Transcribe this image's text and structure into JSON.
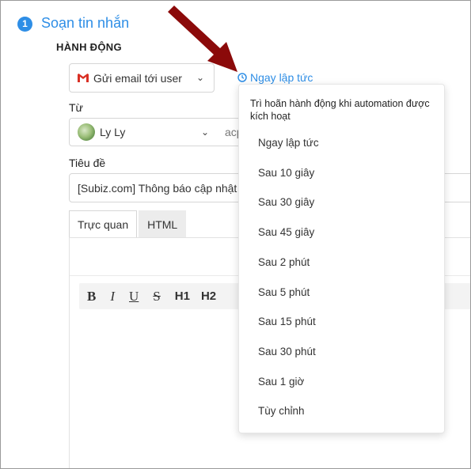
{
  "step": {
    "number": "1",
    "title": "Soạn tin nhắn"
  },
  "action": {
    "section_label": "HÀNH ĐỘNG",
    "selected": "Gửi email tới user",
    "icon": "gmail-icon",
    "timing_link": "Ngay lập tức"
  },
  "from": {
    "label": "Từ",
    "name": "Ly Ly",
    "email_partial": "acp"
  },
  "subject": {
    "label": "Tiêu đề",
    "value": "[Subiz.com] Thông báo cập nhật"
  },
  "editor": {
    "tabs": [
      "Trực quan",
      "HTML"
    ],
    "toolbar": [
      "B",
      "I",
      "U",
      "S",
      "H1",
      "H2"
    ]
  },
  "dropdown": {
    "hint": "Trì hoãn hành động khi automation được kích hoạt",
    "options": [
      "Ngay lập tức",
      "Sau 10 giây",
      "Sau 30 giây",
      "Sau 45 giây",
      "Sau 2 phút",
      "Sau 5 phút",
      "Sau 15 phút",
      "Sau 30 phút",
      "Sau 1 giờ",
      "Tùy chỉnh"
    ]
  },
  "colors": {
    "accent": "#2e8ee6",
    "arrow": "#8b0a0a",
    "gmail_red": "#d93025"
  }
}
